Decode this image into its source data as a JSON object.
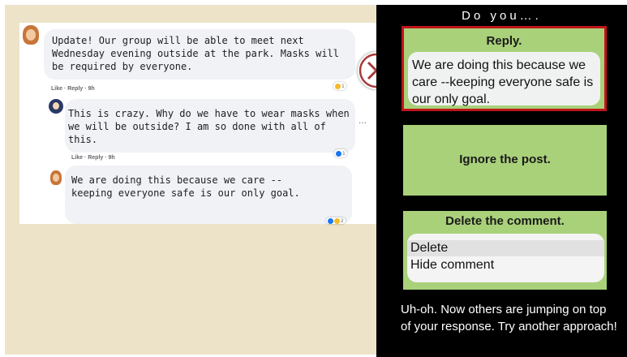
{
  "post": {
    "comment1": {
      "text": "Update!  Our group will be able to meet next Wednesday evening outside at the park.  Masks will be required by everyone.",
      "actions": "Like · Reply · 9h",
      "reaction_count": "1"
    },
    "comment2": {
      "text": "This is crazy. Why do we have to wear masks when we will be outside? I am so done with all of this.",
      "actions": "Like · Reply · 9h",
      "reaction_count": "1"
    },
    "comment3": {
      "text": "We are doing this because we care --keeping everyone safe is our only goal.",
      "reaction_count": "2"
    },
    "more_icon": "ellipsis-icon"
  },
  "panel": {
    "title": "Do you….",
    "reply": {
      "heading": "Reply.",
      "text": "We are doing this because we care --keeping everyone safe is our only goal."
    },
    "ignore": {
      "heading": "Ignore the post."
    },
    "delete": {
      "heading": "Delete the comment.",
      "options": [
        "Delete",
        "Hide comment"
      ]
    },
    "feedback": "Uh-oh. Now others are jumping on top of your response. Try another approach!"
  },
  "colors": {
    "card_green": "#a9d17a",
    "selected_border": "#c0151b",
    "x_mark": "#a83a3a",
    "panel_bg": "#000000",
    "left_bg": "#ece3c9"
  },
  "icons": {
    "wrong": "x-mark-icon",
    "reaction_haha": "haha-reaction-icon",
    "reaction_like": "like-reaction-icon"
  }
}
